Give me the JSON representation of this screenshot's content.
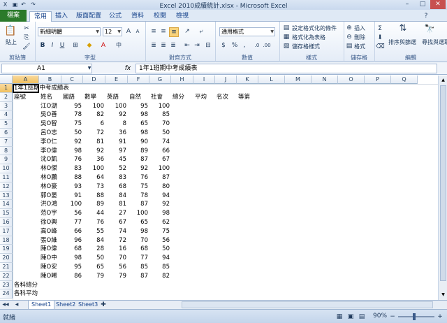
{
  "window": {
    "title": "Excel 2010成績統計.xlsx - Microsoft Excel"
  },
  "tabs": {
    "file": "檔案",
    "items": [
      "常用",
      "插入",
      "版面配置",
      "公式",
      "資料",
      "校閱",
      "檢視"
    ],
    "active": 0
  },
  "ribbon": {
    "clipboard": {
      "label": "剪貼簿",
      "paste": "貼上"
    },
    "font": {
      "label": "字型",
      "name": "新細明體",
      "size": "12",
      "bold": "B",
      "italic": "I",
      "underline": "U"
    },
    "alignment": {
      "label": "對齊方式"
    },
    "number": {
      "label": "數值",
      "format": "通用格式"
    },
    "styles": {
      "label": "樣式",
      "conditional": "設定格式化的條件",
      "as_table": "格式化為表格",
      "cell_styles": "儲存格樣式"
    },
    "cells": {
      "label": "儲存格",
      "insert": "插入",
      "delete": "刪除",
      "format": "格式"
    },
    "editing": {
      "label": "編輯",
      "sort": "排序與篩選",
      "find": "尋找與選取"
    }
  },
  "formula_bar": {
    "name_box": "A1",
    "fx": "fx",
    "formula": "1年1班期中考成績表"
  },
  "columns": [
    "A",
    "B",
    "C",
    "D",
    "E",
    "F",
    "G",
    "H",
    "I",
    "J",
    "K",
    "L",
    "M",
    "N",
    "O",
    "P",
    "Q"
  ],
  "rows": [
    "1",
    "2",
    "3",
    "4",
    "5",
    "6",
    "7",
    "8",
    "9",
    "10",
    "11",
    "12",
    "13",
    "14",
    "15",
    "16",
    "17",
    "18",
    "19",
    "20",
    "21",
    "22",
    "23",
    "24"
  ],
  "sheet": {
    "title": "1年1班期中考成績表",
    "headers": [
      "座號",
      "姓名",
      "國語",
      "數學",
      "英語",
      "自然",
      "社會",
      "總分",
      "平均",
      "名次",
      "等第"
    ],
    "students": [
      {
        "name": "江O湖",
        "scores": [
          "95",
          "100",
          "100",
          "95",
          "100"
        ]
      },
      {
        "name": "吳O善",
        "scores": [
          "78",
          "82",
          "92",
          "98",
          "85"
        ]
      },
      {
        "name": "吳O智",
        "scores": [
          "75",
          "6",
          "8",
          "65",
          "70"
        ]
      },
      {
        "name": "呂O志",
        "scores": [
          "50",
          "72",
          "36",
          "98",
          "50"
        ]
      },
      {
        "name": "李O仁",
        "scores": [
          "92",
          "81",
          "91",
          "90",
          "74"
        ]
      },
      {
        "name": "李O偉",
        "scores": [
          "98",
          "92",
          "97",
          "89",
          "66"
        ]
      },
      {
        "name": "沈O凱",
        "scores": [
          "76",
          "36",
          "45",
          "87",
          "67"
        ]
      },
      {
        "name": "林O傑",
        "scores": [
          "83",
          "100",
          "52",
          "92",
          "100"
        ]
      },
      {
        "name": "林O鵬",
        "scores": [
          "88",
          "64",
          "83",
          "76",
          "87"
        ]
      },
      {
        "name": "林O豪",
        "scores": [
          "93",
          "73",
          "68",
          "75",
          "80"
        ]
      },
      {
        "name": "郭O晏",
        "scores": [
          "91",
          "88",
          "84",
          "78",
          "94"
        ]
      },
      {
        "name": "洪O鴻",
        "scores": [
          "100",
          "89",
          "81",
          "87",
          "92"
        ]
      },
      {
        "name": "范O宇",
        "scores": [
          "56",
          "44",
          "27",
          "100",
          "98"
        ]
      },
      {
        "name": "徐O興",
        "scores": [
          "77",
          "76",
          "67",
          "65",
          "62"
        ]
      },
      {
        "name": "高O峰",
        "scores": [
          "66",
          "55",
          "74",
          "98",
          "75"
        ]
      },
      {
        "name": "張O維",
        "scores": [
          "96",
          "84",
          "72",
          "70",
          "56"
        ]
      },
      {
        "name": "陳O偉",
        "scores": [
          "68",
          "28",
          "16",
          "68",
          "50"
        ]
      },
      {
        "name": "陳O中",
        "scores": [
          "98",
          "50",
          "70",
          "77",
          "94"
        ]
      },
      {
        "name": "陳O安",
        "scores": [
          "95",
          "65",
          "56",
          "85",
          "85"
        ]
      },
      {
        "name": "陳O晞",
        "scores": [
          "86",
          "79",
          "79",
          "87",
          "82"
        ]
      }
    ],
    "footer": [
      "各科總分",
      "各科平均"
    ]
  },
  "sheet_tabs": [
    "Sheet1",
    "Sheet2",
    "Sheet3"
  ],
  "status": {
    "ready": "就緒",
    "zoom": "90%"
  }
}
